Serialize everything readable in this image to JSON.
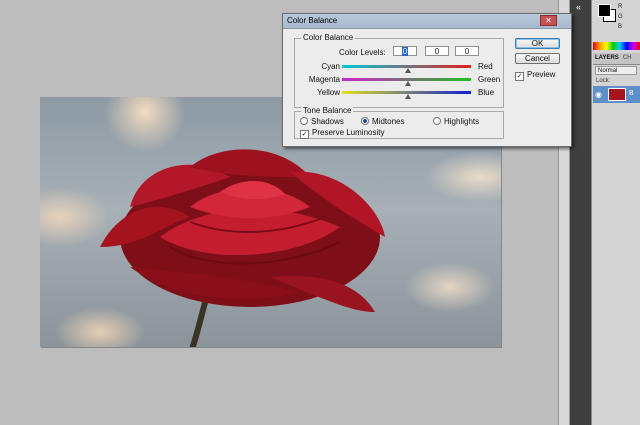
{
  "dialog": {
    "title": "Color Balance",
    "close_glyph": "✕",
    "color_balance_group": "Color Balance",
    "color_levels_label": "Color Levels:",
    "levels": [
      "0",
      "0",
      "0"
    ],
    "sliders": [
      {
        "left": "Cyan",
        "right": "Red",
        "left_color": "#00c8d8",
        "right_color": "#e02020"
      },
      {
        "left": "Magenta",
        "right": "Green",
        "left_color": "#d020d0",
        "right_color": "#20c020"
      },
      {
        "left": "Yellow",
        "right": "Blue",
        "left_color": "#e0e020",
        "right_color": "#1020d0"
      }
    ],
    "tone_balance_group": "Tone Balance",
    "tones": [
      "Shadows",
      "Midtones",
      "Highlights"
    ],
    "selected_tone": "Midtones",
    "preserve_luminosity": "Preserve Luminosity",
    "ok": "OK",
    "cancel": "Cancel",
    "preview": "Preview",
    "check_glyph": "✓"
  },
  "layers_panel": {
    "tabs": [
      "LAYERS",
      "CH"
    ],
    "blend_mode": "Normal",
    "lock_label": "Lock:",
    "layer_name": "B",
    "eye_icon": "eye-icon"
  },
  "swatches": {
    "labels": "R\nG\nB"
  },
  "colors": {
    "rose": "#a5141e",
    "selection": "#5e8fc9"
  }
}
